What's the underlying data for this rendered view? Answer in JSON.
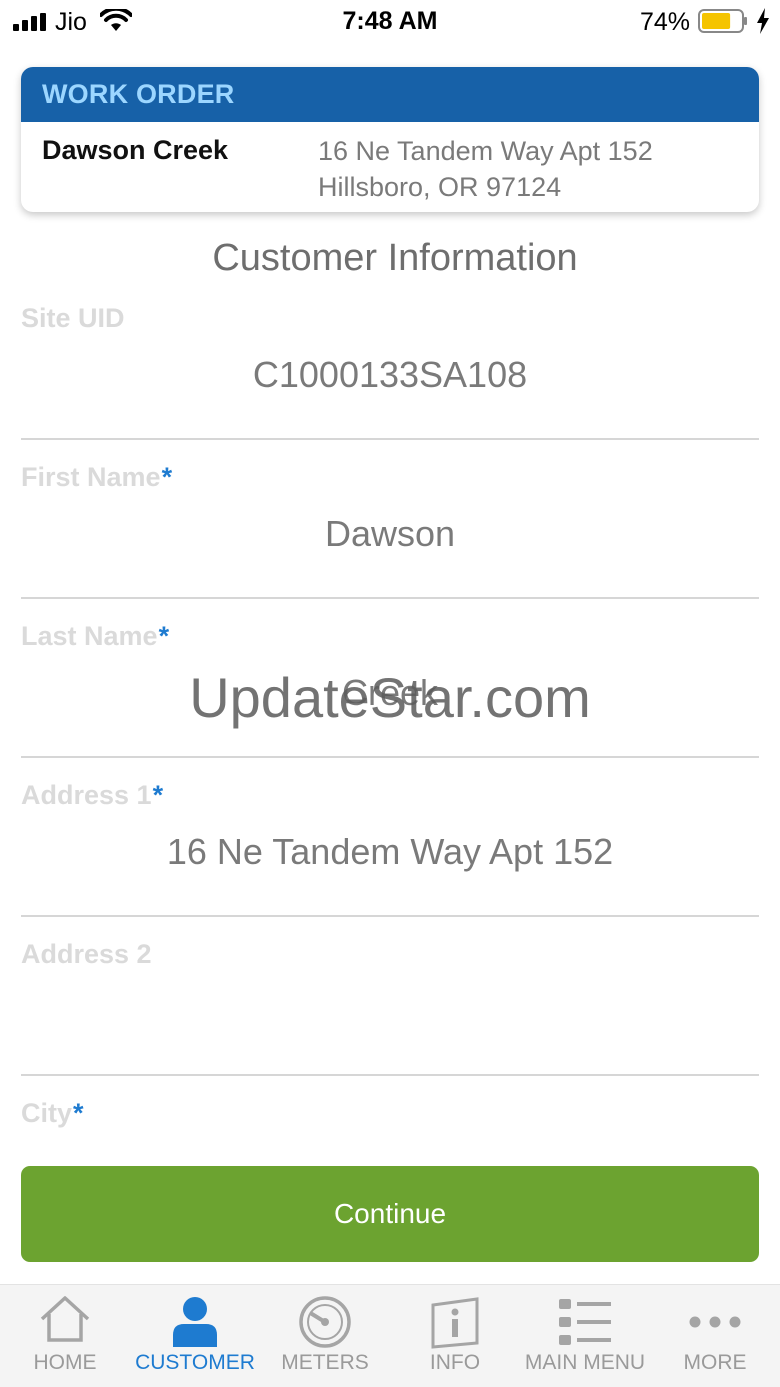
{
  "status_bar": {
    "carrier": "Jio",
    "time": "7:48 AM",
    "battery_percent": "74%",
    "battery_level": 0.74,
    "battery_color": "#f5c400"
  },
  "work_order": {
    "header": "WORK ORDER",
    "customer_name": "Dawson Creek",
    "address_line1": "16 Ne Tandem Way Apt 152",
    "address_line2": "Hillsboro, OR 97124"
  },
  "section_title": "Customer Information",
  "fields": {
    "site_uid": {
      "label": "Site UID",
      "value": "C1000133SA108"
    },
    "first_name": {
      "label": "First Name",
      "required_mark": "*",
      "value": "Dawson"
    },
    "last_name": {
      "label": "Last Name",
      "required_mark": "*",
      "value": "Creek"
    },
    "address1": {
      "label": "Address 1",
      "required_mark": "*",
      "value": "16 Ne Tandem Way Apt 152"
    },
    "address2": {
      "label": "Address 2",
      "value": ""
    },
    "city": {
      "label": "City",
      "required_mark": "*"
    }
  },
  "watermark": "UpdateStar.com",
  "continue_label": "Continue",
  "tabs": [
    {
      "label": "HOME",
      "icon": "home-icon"
    },
    {
      "label": "CUSTOMER",
      "icon": "person-icon",
      "active": true
    },
    {
      "label": "METERS",
      "icon": "meter-gauge-icon"
    },
    {
      "label": "INFO",
      "icon": "info-icon"
    },
    {
      "label": "MAIN MENU",
      "icon": "list-menu-icon"
    },
    {
      "label": "MORE",
      "icon": "more-dots-icon"
    }
  ],
  "colors": {
    "header_blue": "#1761a8",
    "header_text": "#9cd6ff",
    "accent_blue": "#1e7bd0",
    "button_green": "#6ca330"
  }
}
